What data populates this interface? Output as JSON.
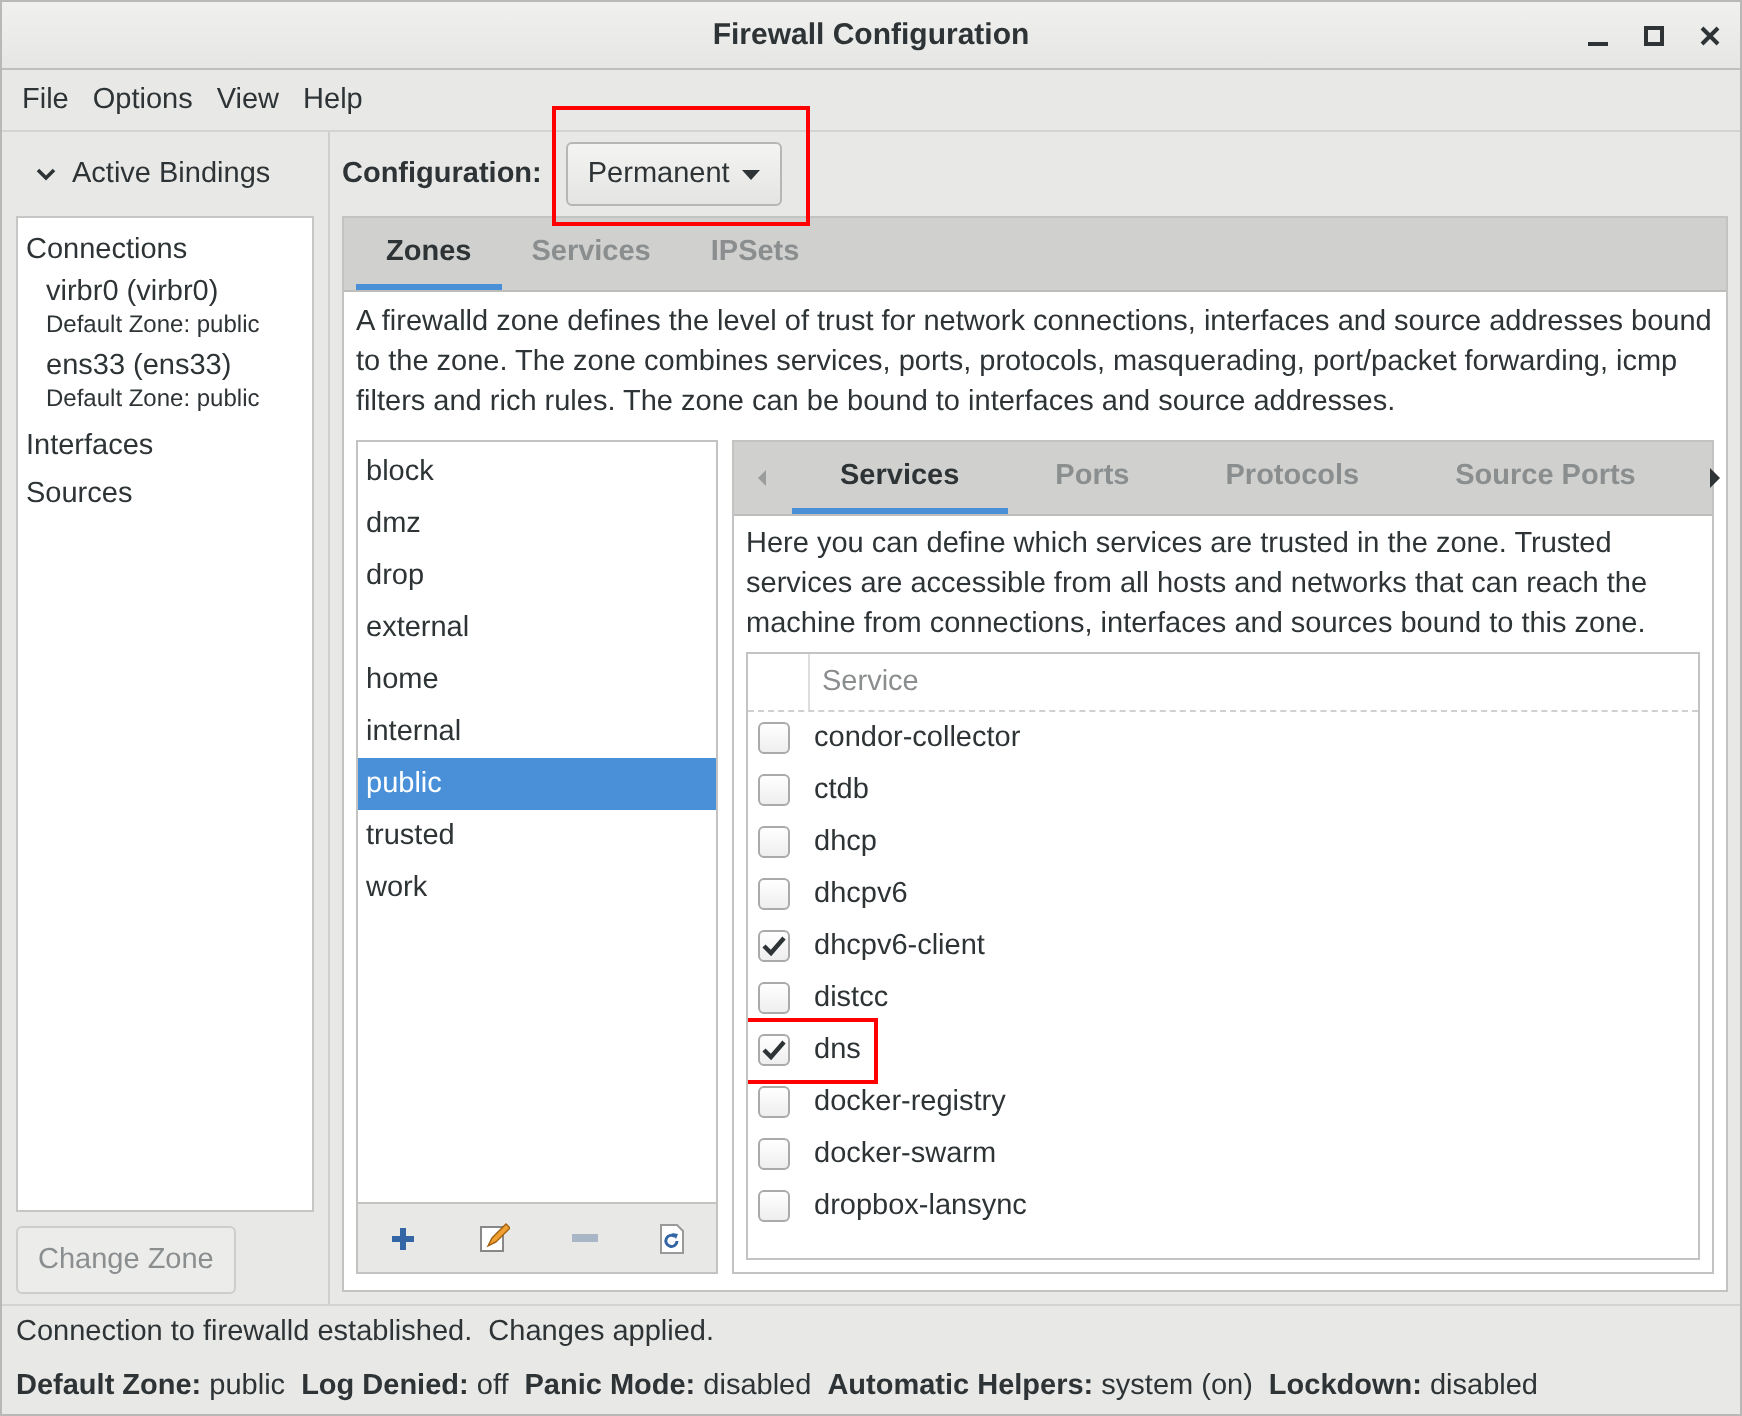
{
  "window": {
    "title": "Firewall Configuration"
  },
  "menu": [
    "File",
    "Options",
    "View",
    "Help"
  ],
  "sidebar": {
    "header": "Active Bindings",
    "expanded": true,
    "sections": [
      {
        "label": "Connections",
        "children": [
          {
            "name": "virbr0 (virbr0)",
            "detail": "Default Zone: public"
          },
          {
            "name": "ens33 (ens33)",
            "detail": "Default Zone: public"
          }
        ]
      },
      {
        "label": "Interfaces"
      },
      {
        "label": "Sources"
      }
    ],
    "button": {
      "label": "Change Zone",
      "disabled": true
    }
  },
  "configuration": {
    "label": "Configuration:",
    "value": "Permanent",
    "highlighted": true
  },
  "tabs": [
    {
      "label": "Zones",
      "selected": true
    },
    {
      "label": "Services",
      "selected": false
    },
    {
      "label": "IPSets",
      "selected": false
    }
  ],
  "zones": {
    "description": "A firewalld zone defines the level of trust for network connections, interfaces and source addresses bound to the zone. The zone combines services, ports, protocols, masquerading, port/packet forwarding, icmp filters and rich rules. The zone can be bound to interfaces and source addresses.",
    "items": [
      {
        "label": "block",
        "selected": false
      },
      {
        "label": "dmz",
        "selected": false
      },
      {
        "label": "drop",
        "selected": false
      },
      {
        "label": "external",
        "selected": false
      },
      {
        "label": "home",
        "selected": false
      },
      {
        "label": "internal",
        "selected": false
      },
      {
        "label": "public",
        "selected": true
      },
      {
        "label": "trusted",
        "selected": false
      },
      {
        "label": "work",
        "selected": false
      }
    ]
  },
  "zone_tabs": [
    {
      "label": "Services",
      "selected": true
    },
    {
      "label": "Ports",
      "selected": false
    },
    {
      "label": "Protocols",
      "selected": false
    },
    {
      "label": "Source Ports",
      "selected": false
    }
  ],
  "services": {
    "description": "Here you can define which services are trusted in the zone. Trusted services are accessible from all hosts and networks that can reach the machine from connections, interfaces and sources bound to this zone.",
    "column": "Service",
    "rows": [
      {
        "name": "condor-collector",
        "checked": false,
        "highlighted": false
      },
      {
        "name": "ctdb",
        "checked": false,
        "highlighted": false
      },
      {
        "name": "dhcp",
        "checked": false,
        "highlighted": false
      },
      {
        "name": "dhcpv6",
        "checked": false,
        "highlighted": false
      },
      {
        "name": "dhcpv6-client",
        "checked": true,
        "highlighted": false
      },
      {
        "name": "distcc",
        "checked": false,
        "highlighted": false
      },
      {
        "name": "dns",
        "checked": true,
        "highlighted": true
      },
      {
        "name": "docker-registry",
        "checked": false,
        "highlighted": false
      },
      {
        "name": "docker-swarm",
        "checked": false,
        "highlighted": false
      },
      {
        "name": "dropbox-lansync",
        "checked": false,
        "highlighted": false
      }
    ]
  },
  "status": "Connection to firewalld established.  Changes applied.",
  "status_fields": [
    {
      "label": "Default Zone:",
      "value": "public"
    },
    {
      "label": "Log Denied:",
      "value": "off"
    },
    {
      "label": "Panic Mode:",
      "value": "disabled"
    },
    {
      "label": "Automatic Helpers:",
      "value": "system (on)"
    },
    {
      "label": "Lockdown:",
      "value": "disabled"
    }
  ]
}
